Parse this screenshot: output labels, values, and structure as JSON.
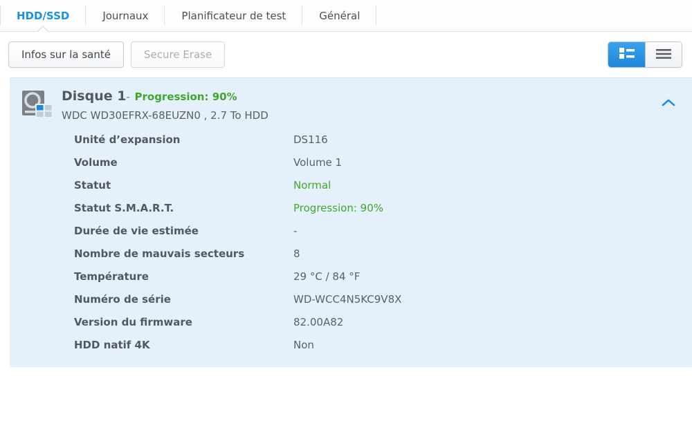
{
  "tabs": [
    {
      "label": "HDD/SSD",
      "active": true
    },
    {
      "label": "Journaux",
      "active": false
    },
    {
      "label": "Planificateur de test",
      "active": false
    },
    {
      "label": "Général",
      "active": false
    }
  ],
  "toolbar": {
    "health_info_label": "Infos sur la santé",
    "secure_erase_label": "Secure Erase",
    "view_detail_icon": "detail-view-icon",
    "view_list_icon": "list-view-icon",
    "accent_color": "#1e86db"
  },
  "disk": {
    "title": "Disque 1",
    "title_separator": "-",
    "progress": "Progression: 90%",
    "model": "WDC WD30EFRX-68EUZN0 , 2.7 To HDD",
    "icon": "hard-disk-icon",
    "collapse_icon": "chevron-up-icon",
    "panel_color": "#e4f1fb",
    "status_color": "#3fa82c",
    "rows": [
      {
        "label": "Unité d’expansion",
        "value": "DS116",
        "green": false
      },
      {
        "label": "Volume",
        "value": "Volume 1",
        "green": false
      },
      {
        "label": "Statut",
        "value": "Normal",
        "green": true
      },
      {
        "label": "Statut S.M.A.R.T.",
        "value": "Progression: 90%",
        "green": true
      },
      {
        "label": "Durée de vie estimée",
        "value": "-",
        "green": false
      },
      {
        "label": "Nombre de mauvais secteurs",
        "value": "8",
        "green": false
      },
      {
        "label": "Température",
        "value": "29 °C / 84 °F",
        "green": false
      },
      {
        "label": "Numéro de série",
        "value": "WD-WCC4N5KC9V8X",
        "green": false
      },
      {
        "label": "Version du firmware",
        "value": "82.00A82",
        "green": false
      },
      {
        "label": "HDD natif 4K",
        "value": "Non",
        "green": false
      }
    ]
  }
}
